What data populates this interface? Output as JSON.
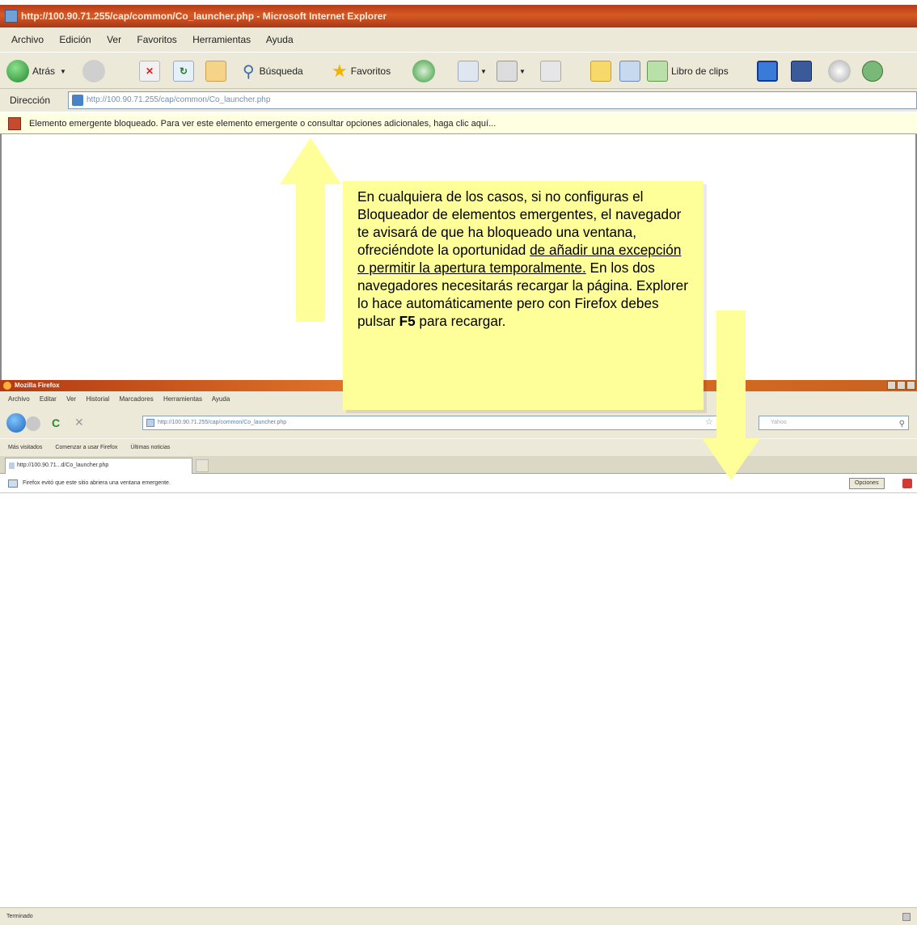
{
  "ie": {
    "title": "http://100.90.71.255/cap/common/Co_launcher.php - Microsoft Internet Explorer",
    "menu": [
      "Archivo",
      "Edición",
      "Ver",
      "Favoritos",
      "Herramientas",
      "Ayuda"
    ],
    "toolbar": {
      "back_label": "Atrás",
      "search_label": "Búsqueda",
      "favorites_label": "Favoritos",
      "clipbook_label": "Libro de clips"
    },
    "address": {
      "label": "Dirección",
      "value": "http://100.90.71.255/cap/common/Co_launcher.php"
    },
    "infobar_text": "Elemento emergente bloqueado. Para ver este elemento emergente o consultar opciones adicionales, haga clic aquí..."
  },
  "firefox": {
    "title": "Mozilla Firefox",
    "menu": [
      "Archivo",
      "Editar",
      "Ver",
      "Historial",
      "Marcadores",
      "Herramientas",
      "Ayuda"
    ],
    "url": "http://100.90.71.255/cap/common/Co_launcher.php",
    "search_placeholder": "Yahoo",
    "bookmarks": [
      "Más visitados",
      "Comenzar a usar Firefox",
      "Últimas noticias"
    ],
    "tab_label": "http://100.90.71...d/Co_launcher.php",
    "notice_text": "Firefox evitó que este sitio abriera una ventana emergente.",
    "options_label": "Opciones",
    "status_text": "Terminado"
  },
  "annotation": {
    "text_before": "En cualquiera de los casos, si no configuras el Bloqueador de elementos emergentes, el navegador te avisará de que ha bloqueado una ventana, ofreciéndote la oportunidad ",
    "text_underlined": "de añadir una excepción o permitir la apertura temporalmente.",
    "text_middle": " En los dos navegadores necesitarás recargar la página. Explorer lo hace automáticamente pero con Firefox debes pulsar ",
    "text_bold": "F5",
    "text_after": " para recargar."
  },
  "colors": {
    "note_background": "#ffff99",
    "arrow_fill": "#ffff99",
    "infobar_background": "#ffffe1"
  },
  "icons": [
    "ie-page-icon",
    "back-icon",
    "forward-icon",
    "stop-icon",
    "refresh-icon",
    "home-icon",
    "search-icon",
    "favorites-icon",
    "history-icon",
    "mail-icon",
    "print-icon",
    "popup-blocked-icon",
    "firefox-icon",
    "bookmark-star-icon"
  ]
}
